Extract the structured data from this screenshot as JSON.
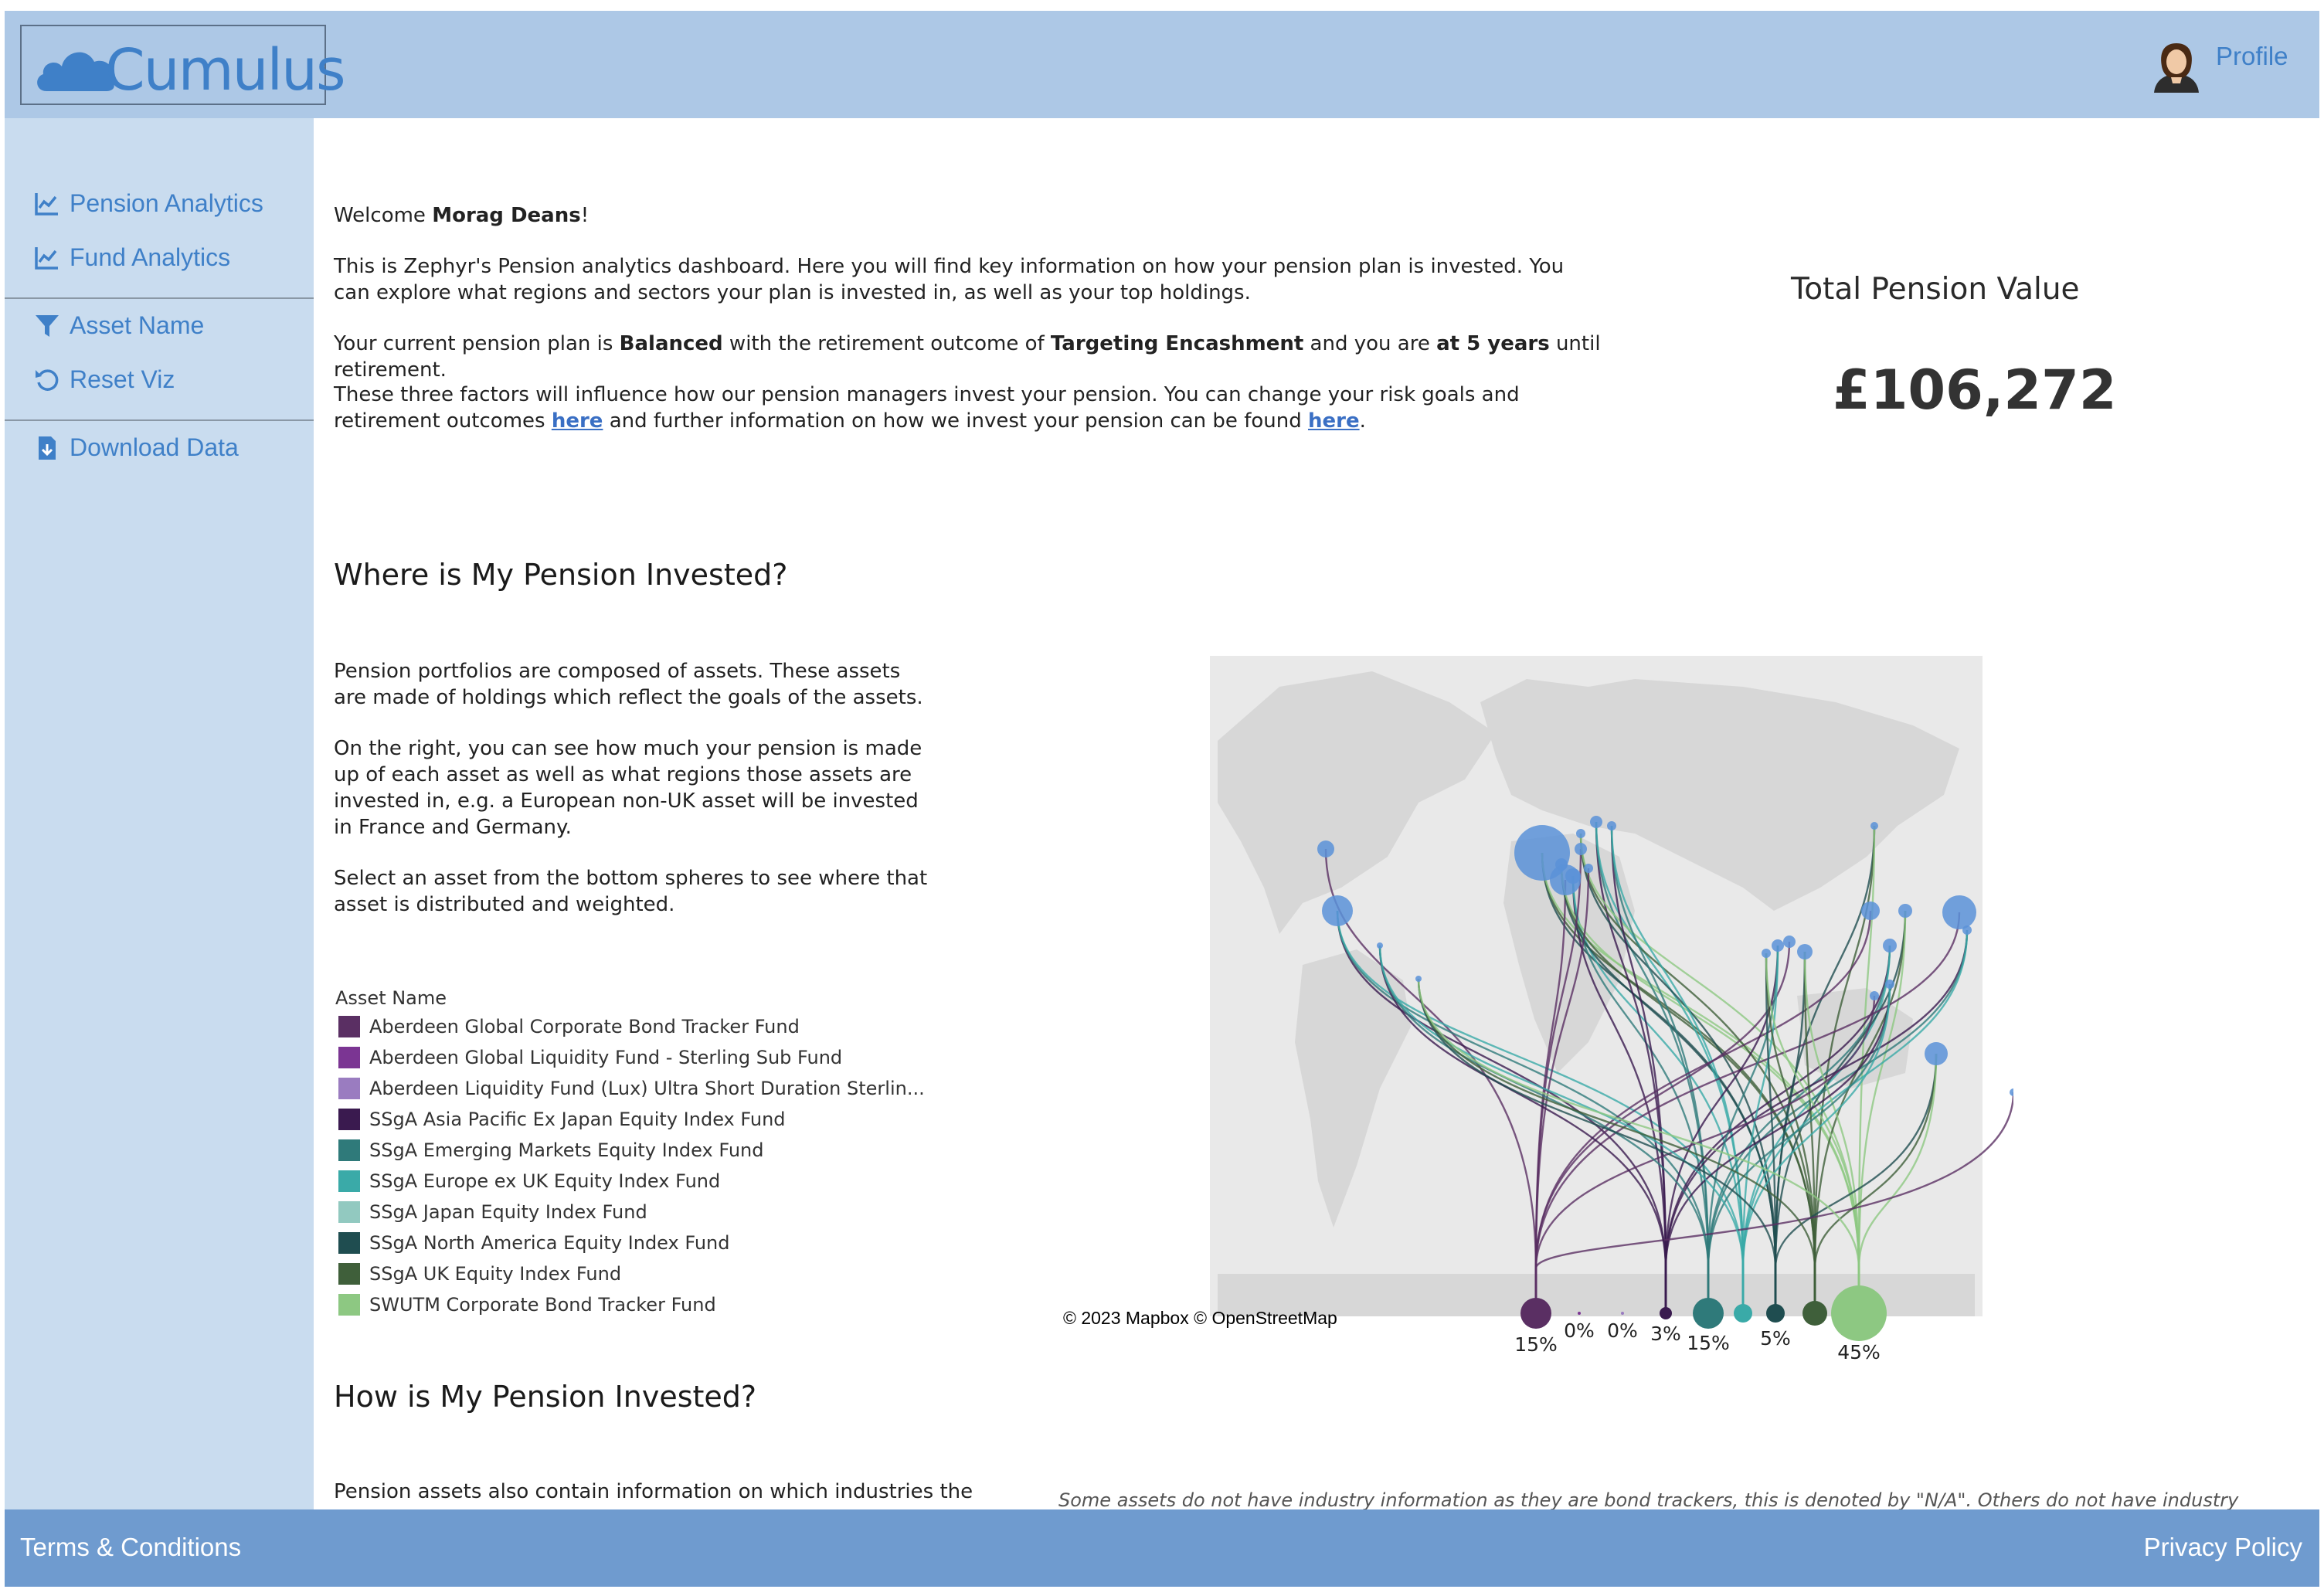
{
  "header": {
    "logo_text": "Cumulus",
    "profile_label": "Profile"
  },
  "sidebar": {
    "items": [
      {
        "label": "Pension Analytics",
        "icon": "line-chart-icon"
      },
      {
        "label": "Fund Analytics",
        "icon": "line-chart-icon"
      },
      {
        "label": "Asset Name",
        "icon": "filter-icon"
      },
      {
        "label": "Reset Viz",
        "icon": "reset-icon"
      },
      {
        "label": "Download Data",
        "icon": "download-icon"
      }
    ]
  },
  "intro": {
    "welcome_prefix": "Welcome ",
    "user_name": "Morag Deans",
    "welcome_suffix": "!",
    "para1": "This is Zephyr's Pension analytics dashboard. Here you will find key information on how your pension plan is invested. You can explore what regions and sectors your plan is invested in, as well as your top holdings.",
    "para2_a": "Your current pension plan is ",
    "plan_type": "Balanced",
    "para2_b": " with the retirement outcome of ",
    "outcome": "Targeting Encashment",
    "para2_c": " and you are ",
    "years": "at 5 years",
    "para2_d": " until retirement.",
    "para3_a": "These three factors will influence how our pension managers invest your pension. You can change your risk goals and retirement outcomes ",
    "link1": "here",
    "para3_b": " and further information on how we invest your pension can be found ",
    "link2": "here",
    "para3_c": "."
  },
  "kpi": {
    "label": "Total Pension Value",
    "value": "£106,272"
  },
  "where_section": {
    "heading": "Where is My Pension Invested?",
    "para1": "Pension portfolios are composed of assets. These assets are made of holdings which reflect the goals of the assets.",
    "para2": "On the right, you can see how much your pension is made up of each asset as well as what regions those assets are invested in, e.g. a European non-UK asset will be invested in France and Germany.",
    "para3": "Select an asset from the bottom spheres to see where that asset is distributed and weighted."
  },
  "legend": {
    "title": "Asset Name",
    "items": [
      {
        "label": "Aberdeen Global Corporate Bond Tracker Fund",
        "color": "#5a2f63"
      },
      {
        "label": "Aberdeen Global Liquidity Fund - Sterling Sub Fund",
        "color": "#7b3593"
      },
      {
        "label": "Aberdeen Liquidity Fund (Lux) Ultra Short Duration Sterlin...",
        "color": "#9a7cc0"
      },
      {
        "label": "SSgA Asia Pacific Ex Japan Equity Index Fund",
        "color": "#3a1a4f"
      },
      {
        "label": "SSgA Emerging Markets Equity Index Fund",
        "color": "#2f7a7a"
      },
      {
        "label": "SSgA Europe ex UK Equity Index Fund",
        "color": "#3aaaa8"
      },
      {
        "label": "SSgA Japan Equity Index Fund",
        "color": "#92c9c0"
      },
      {
        "label": "SSgA North America Equity Index Fund",
        "color": "#1f4d50"
      },
      {
        "label": "SSgA UK Equity Index Fund",
        "color": "#3f5f3a"
      },
      {
        "label": "SWUTM Corporate Bond Tracker Fund",
        "color": "#8dc882"
      }
    ]
  },
  "map": {
    "attribution": "© 2023 Mapbox  © OpenStreetMap",
    "allocations": [
      {
        "label": "15%",
        "value": 15,
        "color": "#5a2f63"
      },
      {
        "label": "0%",
        "value": 0,
        "color": "#7b3593"
      },
      {
        "label": "0%",
        "value": 0,
        "color": "#9a7cc0"
      },
      {
        "label": "3%",
        "value": 3,
        "color": "#3a1a4f"
      },
      {
        "label": "15%",
        "value": 15,
        "color": "#2f7a7a"
      },
      {
        "label": "",
        "value": 2,
        "color": "#3aaaa8"
      },
      {
        "label": "5%",
        "value": 5,
        "color": "#1f4d50"
      },
      {
        "label": "",
        "value": 4,
        "color": "#3f5f3a"
      },
      {
        "label": "45%",
        "value": 45,
        "color": "#8dc882"
      }
    ]
  },
  "how_section": {
    "heading": "How is My Pension Invested?",
    "para1": "Pension assets also contain information on which industries the",
    "note": "Some assets do not have industry information as they are bond trackers, this is denoted by \"N/A\". Others do not have industry"
  },
  "footer": {
    "terms": "Terms & Conditions",
    "privacy": "Privacy Policy"
  }
}
